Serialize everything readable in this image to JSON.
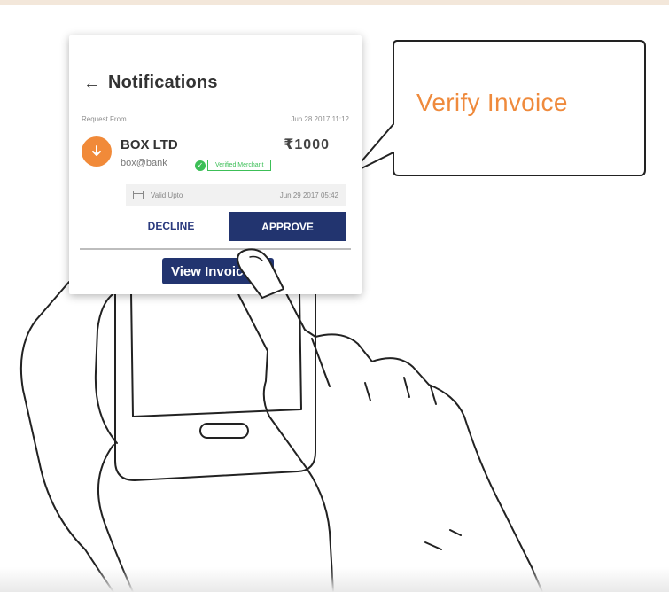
{
  "notification_card": {
    "back_icon": "←",
    "title": "Notifications",
    "request_label": "Request From",
    "request_date": "Jun 28 2017 11:12",
    "sender": {
      "avatar_icon": "download-arrow-icon",
      "name": "BOX LTD",
      "handle": "box@bank",
      "amount": "₹1000",
      "verified_label": "Verified Merchant"
    },
    "validity": {
      "icon": "calendar-icon",
      "label": "Valid Upto",
      "date": "Jun 29 2017 05:42"
    },
    "decline_label": "DECLINE",
    "approve_label": "APPROVE",
    "view_invoice_label": "View Invoice"
  },
  "callout": {
    "text": "Verify Invoice"
  },
  "colors": {
    "accent_orange": "#ef8a3c",
    "primary_navy": "#22346f",
    "verified_green": "#3cbf57"
  }
}
